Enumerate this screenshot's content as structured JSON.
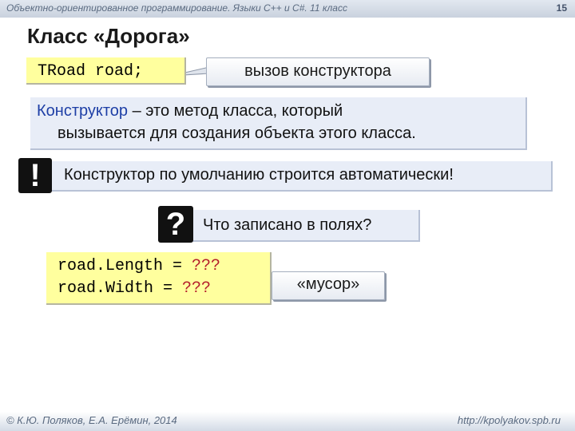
{
  "header": {
    "text": "Объектно-ориентированное программирование. Языки C++ и C#. 11 класс",
    "page_number": "15"
  },
  "title": "Класс «Дорога»",
  "declaration": {
    "code": "TRoad road;",
    "callout": "вызов конструктора"
  },
  "definition": {
    "term": "Конструктор",
    "rest_line1": " – это метод класса, который",
    "line2": "вызывается для создания объекта этого класса."
  },
  "note": {
    "icon": "!",
    "text": "Конструктор по умолчанию строится автоматически!"
  },
  "question": {
    "icon": "?",
    "text": "Что записано в полях?"
  },
  "fields": {
    "line1_code": "road.Length",
    "line1_eq": " = ",
    "line1_val": "???",
    "line2_code": "road.Width",
    "line2_eq": " = ",
    "line2_val": "???",
    "callout": "«мусор»"
  },
  "footer": {
    "left": "© К.Ю. Поляков, Е.А. Ерёмин, 2014",
    "right": "http://kpolyakov.spb.ru"
  },
  "colors": {
    "term": "#1e3fa6",
    "value": "#b31d2b",
    "code_bg": "#ffff9e",
    "box_bg": "#e8edf7"
  }
}
